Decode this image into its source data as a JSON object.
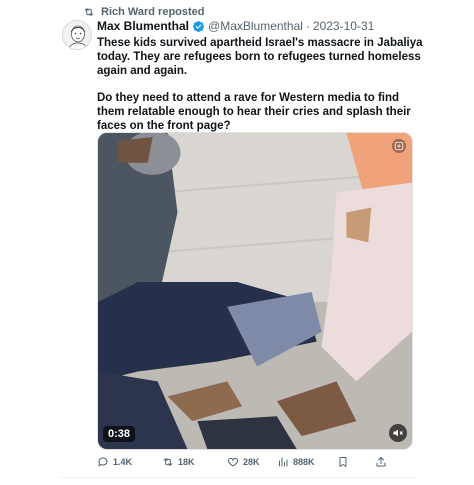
{
  "repost": {
    "icon": "repost-icon",
    "label": "Rich Ward reposted"
  },
  "tweet": {
    "author_name": "Max Blumenthal",
    "verified_icon": "verified-badge-icon",
    "verified_color": "#1d9bf0",
    "handle": "@MaxBlumenthal",
    "separator": "·",
    "date": "2023-10-31",
    "paragraphs": [
      "These kids survived apartheid Israel's massacre in Jabaliya today. They are refugees born to refugees turned homeless again and again.",
      "Do they need to attend a rave for Western media to find them relatable enough to hear their cries and splash their faces on the front page?"
    ]
  },
  "media": {
    "duration": "0:38",
    "mute_icon": "speaker-muted-icon",
    "corner_icon": "gif-icon"
  },
  "actions": {
    "replies": "1.4K",
    "reposts": "18K",
    "likes": "28K",
    "views": "888K"
  }
}
